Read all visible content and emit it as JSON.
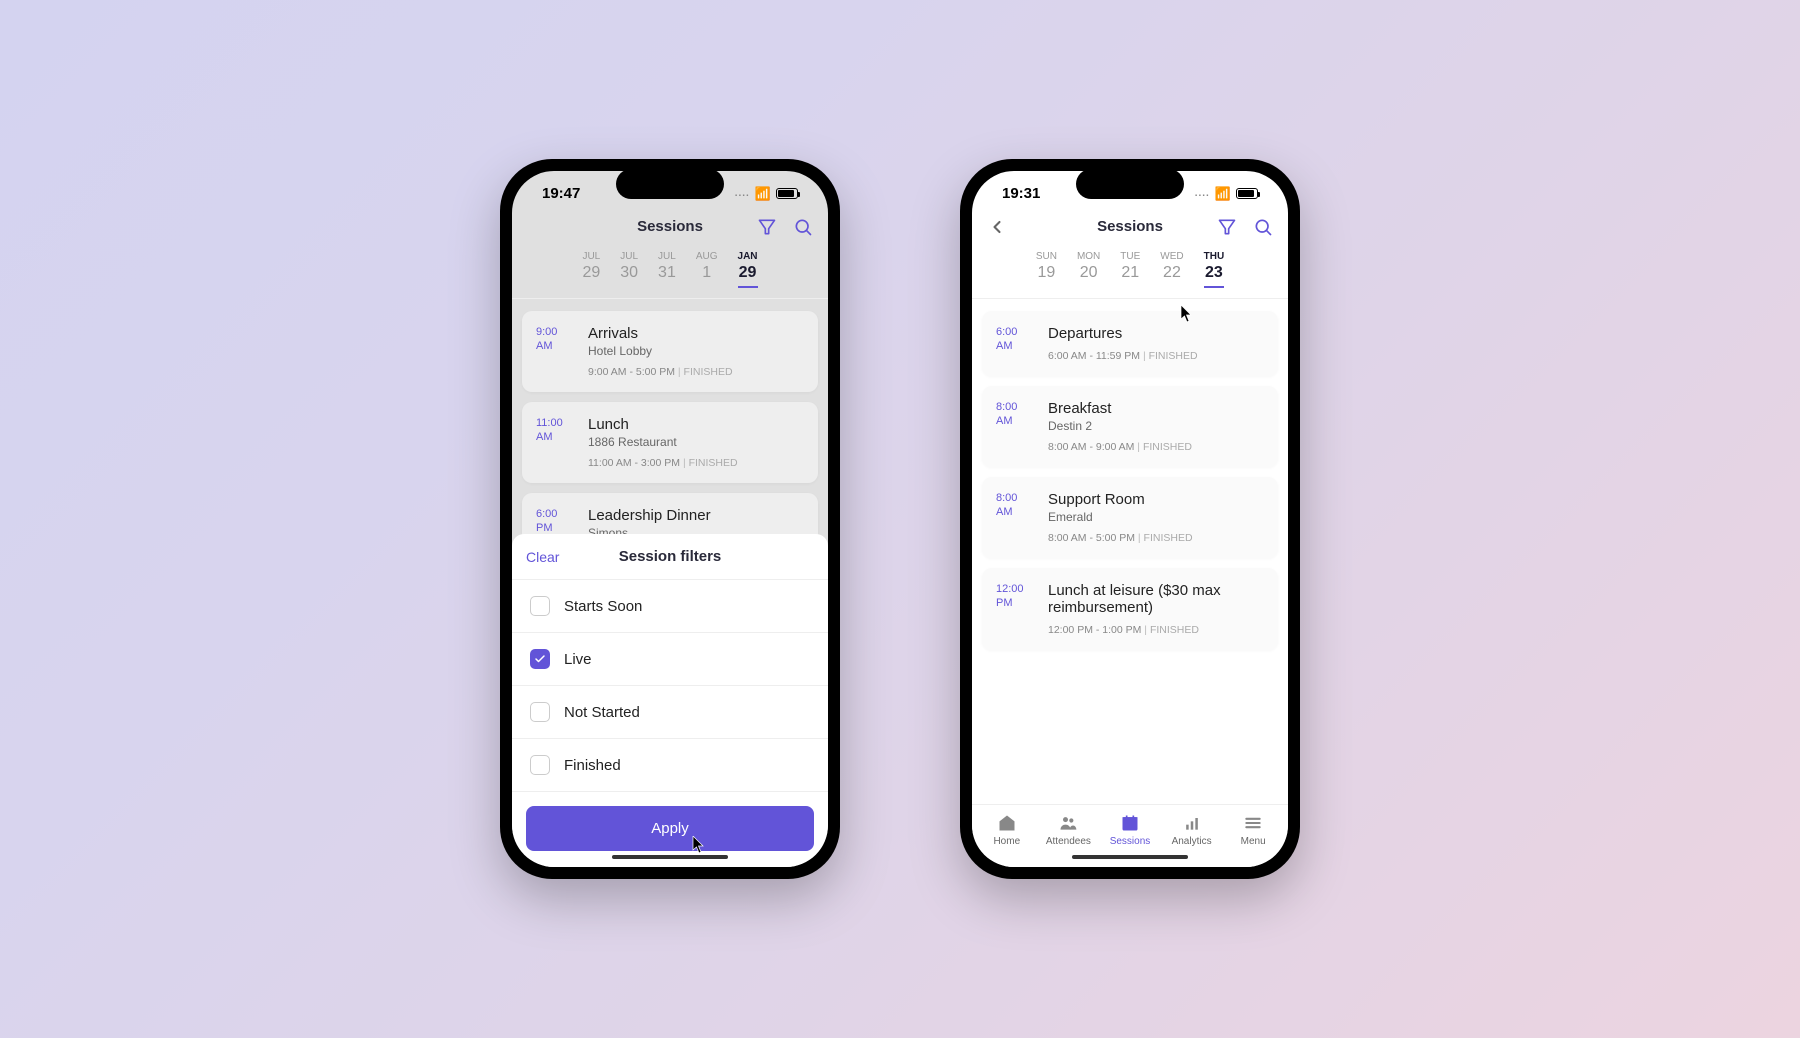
{
  "leftPhone": {
    "time": "19:47",
    "headerTitle": "Sessions",
    "dateTabs": [
      {
        "day": "JUL",
        "num": "29"
      },
      {
        "day": "JUL",
        "num": "30"
      },
      {
        "day": "JUL",
        "num": "31"
      },
      {
        "day": "AUG",
        "num": "1"
      },
      {
        "day": "JAN",
        "num": "29",
        "active": true
      }
    ],
    "sessions": [
      {
        "time": "9:00 AM",
        "title": "Arrivals",
        "location": "Hotel Lobby",
        "range": "9:00 AM - 5:00 PM",
        "status": "FINISHED"
      },
      {
        "time": "11:00 AM",
        "title": "Lunch",
        "location": "1886 Restaurant",
        "range": "11:00 AM - 3:00 PM",
        "status": "FINISHED"
      },
      {
        "time": "6:00 PM",
        "title": "Leadership Dinner",
        "location": "Simons",
        "range": "",
        "status": ""
      }
    ],
    "sheet": {
      "clear": "Clear",
      "title": "Session filters",
      "filters": [
        {
          "label": "Starts Soon",
          "checked": false
        },
        {
          "label": "Live",
          "checked": true
        },
        {
          "label": "Not Started",
          "checked": false
        },
        {
          "label": "Finished",
          "checked": false
        }
      ],
      "apply": "Apply"
    }
  },
  "rightPhone": {
    "time": "19:31",
    "headerTitle": "Sessions",
    "dateTabs": [
      {
        "day": "SUN",
        "num": "19"
      },
      {
        "day": "MON",
        "num": "20"
      },
      {
        "day": "TUE",
        "num": "21"
      },
      {
        "day": "WED",
        "num": "22"
      },
      {
        "day": "THU",
        "num": "23",
        "active": true
      }
    ],
    "sessions": [
      {
        "time": "6:00 AM",
        "title": "Departures",
        "location": "",
        "range": "6:00 AM - 11:59 PM",
        "status": "FINISHED"
      },
      {
        "time": "8:00 AM",
        "title": "Breakfast",
        "location": "Destin 2",
        "range": "8:00 AM - 9:00 AM",
        "status": "FINISHED"
      },
      {
        "time": "8:00 AM",
        "title": "Support Room",
        "location": "Emerald",
        "range": "8:00 AM - 5:00 PM",
        "status": "FINISHED"
      },
      {
        "time": "12:00 PM",
        "title": "Lunch at leisure ($30 max reimbursement)",
        "location": "",
        "range": "12:00 PM - 1:00 PM",
        "status": "FINISHED"
      }
    ],
    "tabs": [
      {
        "label": "Home"
      },
      {
        "label": "Attendees"
      },
      {
        "label": "Sessions",
        "active": true
      },
      {
        "label": "Analytics"
      },
      {
        "label": "Menu"
      }
    ]
  }
}
